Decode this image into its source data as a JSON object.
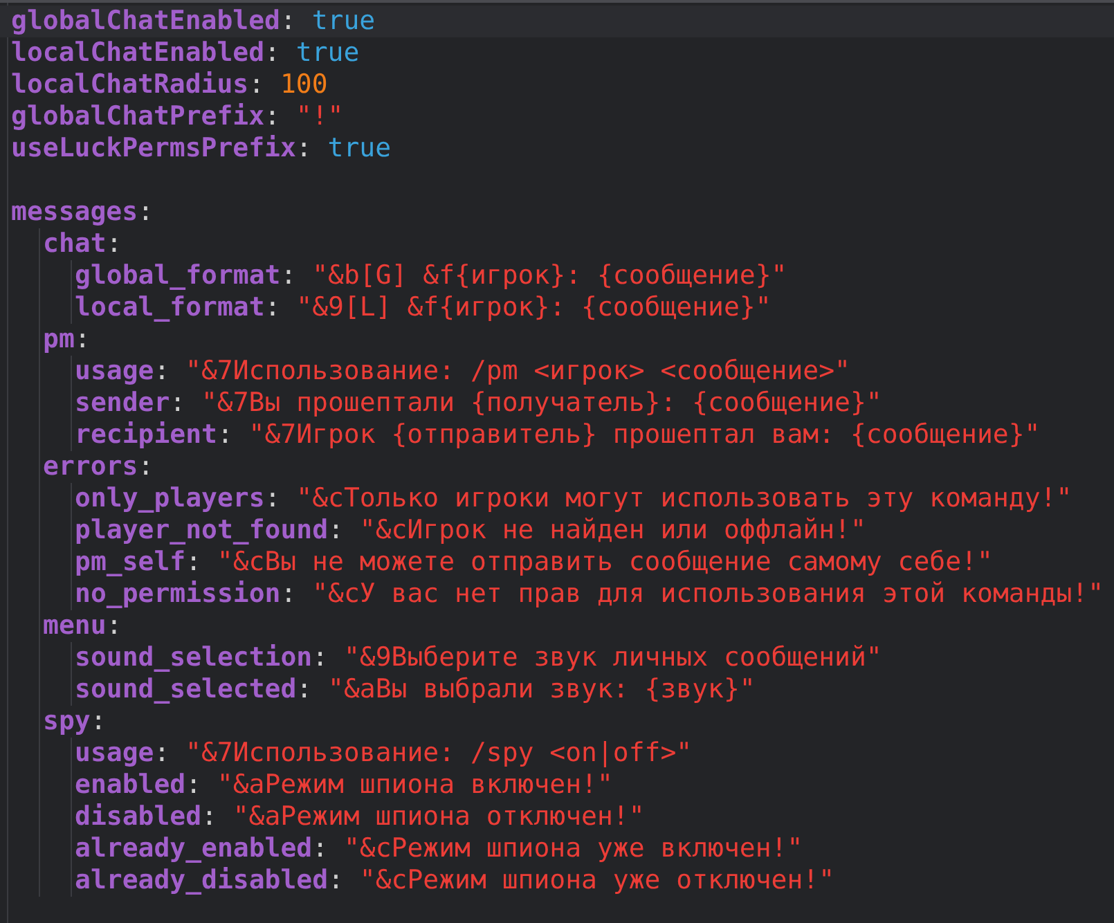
{
  "entries": [
    {
      "key": "globalChatEnabled",
      "colon": ":",
      "kind": "bool",
      "value": "true",
      "highlighted": true
    },
    {
      "key": "localChatEnabled",
      "colon": ":",
      "kind": "bool",
      "value": "true",
      "highlighted": false
    },
    {
      "key": "localChatRadius",
      "colon": ":",
      "kind": "number",
      "value": "100",
      "highlighted": false
    },
    {
      "key": "globalChatPrefix",
      "colon": ":",
      "kind": "string",
      "value": "\"!\"",
      "highlighted": false
    },
    {
      "key": "useLuckPermsPrefix",
      "colon": ":",
      "kind": "bool",
      "value": "true",
      "highlighted": false
    },
    {
      "key": "messages",
      "colon": ":",
      "kind": "section",
      "blank_before": true,
      "highlighted": false,
      "children": [
        {
          "key": "chat",
          "colon": ":",
          "kind": "section",
          "highlighted": false,
          "children": [
            {
              "key": "global_format",
              "colon": ":",
              "kind": "string",
              "value": "\"&b[G] &f{игрок}: {сообщение}\"",
              "highlighted": false
            },
            {
              "key": "local_format",
              "colon": ":",
              "kind": "string",
              "value": "\"&9[L] &f{игрок}: {сообщение}\"",
              "highlighted": false
            }
          ]
        },
        {
          "key": "pm",
          "colon": ":",
          "kind": "section",
          "highlighted": false,
          "children": [
            {
              "key": "usage",
              "colon": ":",
              "kind": "string",
              "value": "\"&7Использование: /pm <игрок> <сообщение>\"",
              "highlighted": false
            },
            {
              "key": "sender",
              "colon": ":",
              "kind": "string",
              "value": "\"&7Вы прошептали {получатель}: {сообщение}\"",
              "highlighted": false
            },
            {
              "key": "recipient",
              "colon": ":",
              "kind": "string",
              "value": "\"&7Игрок {отправитель} прошептал вам: {сообщение}\"",
              "highlighted": false
            }
          ]
        },
        {
          "key": "errors",
          "colon": ":",
          "kind": "section",
          "highlighted": false,
          "children": [
            {
              "key": "only_players",
              "colon": ":",
              "kind": "string",
              "value": "\"&cТолько игроки могут использовать эту команду!\"",
              "highlighted": false
            },
            {
              "key": "player_not_found",
              "colon": ":",
              "kind": "string",
              "value": "\"&cИгрок не найден или оффлайн!\"",
              "highlighted": false
            },
            {
              "key": "pm_self",
              "colon": ":",
              "kind": "string",
              "value": "\"&cВы не можете отправить сообщение самому себе!\"",
              "highlighted": false
            },
            {
              "key": "no_permission",
              "colon": ":",
              "kind": "string",
              "value": "\"&cУ вас нет прав для использования этой команды!\"",
              "highlighted": false
            }
          ]
        },
        {
          "key": "menu",
          "colon": ":",
          "kind": "section",
          "highlighted": false,
          "children": [
            {
              "key": "sound_selection",
              "colon": ":",
              "kind": "string",
              "value": "\"&9Выберите звук личных сообщений\"",
              "highlighted": false
            },
            {
              "key": "sound_selected",
              "colon": ":",
              "kind": "string",
              "value": "\"&aВы выбрали звук: {звук}\"",
              "highlighted": false
            }
          ]
        },
        {
          "key": "spy",
          "colon": ":",
          "kind": "section",
          "highlighted": false,
          "children": [
            {
              "key": "usage",
              "colon": ":",
              "kind": "string",
              "value": "\"&7Использование: /spy <on|off>\"",
              "highlighted": false
            },
            {
              "key": "enabled",
              "colon": ":",
              "kind": "string",
              "value": "\"&aРежим шпиона включен!\"",
              "highlighted": false
            },
            {
              "key": "disabled",
              "colon": ":",
              "kind": "string",
              "value": "\"&aРежим шпиона отключен!\"",
              "highlighted": false
            },
            {
              "key": "already_enabled",
              "colon": ":",
              "kind": "string",
              "value": "\"&cРежим шпиона уже включен!\"",
              "highlighted": false
            },
            {
              "key": "already_disabled",
              "colon": ":",
              "kind": "string",
              "value": "\"&cРежим шпиона уже отключен!\"",
              "highlighted": false
            }
          ]
        }
      ]
    }
  ]
}
